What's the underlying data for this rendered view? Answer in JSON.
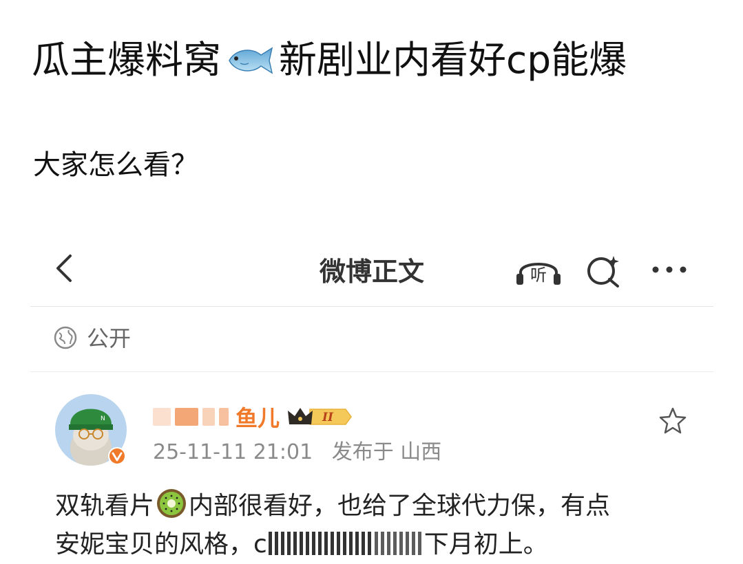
{
  "post": {
    "title_part1": "瓜主爆料窝",
    "title_part2": "新剧业内看好cp能爆",
    "subtitle": "大家怎么看？"
  },
  "weibo": {
    "nav_title": "微博正文",
    "listen_label": "听",
    "visibility_label": "公开",
    "username_visible": "鱼儿",
    "vip_level": "II",
    "timestamp": "25-11-11 21:01",
    "location": "发布于 山西",
    "content_line1_a": "双轨看片",
    "content_line1_b": "内部很看好，也给了全球代力保，有点",
    "content_line2_a": "安妮宝贝的风格，c",
    "content_line2_b": "下月初上。"
  },
  "colors": {
    "accent_orange": "#f07a2a",
    "vip_gold": "#e9b23a",
    "text_gray": "#8a8a8a"
  },
  "icons": [
    "fish-emoji-icon",
    "back-arrow-icon",
    "listen-icon",
    "search-sparkle-icon",
    "more-icon",
    "globe-icon",
    "star-icon",
    "kiwi-emoji-icon",
    "verified-badge-icon",
    "crown-icon"
  ]
}
